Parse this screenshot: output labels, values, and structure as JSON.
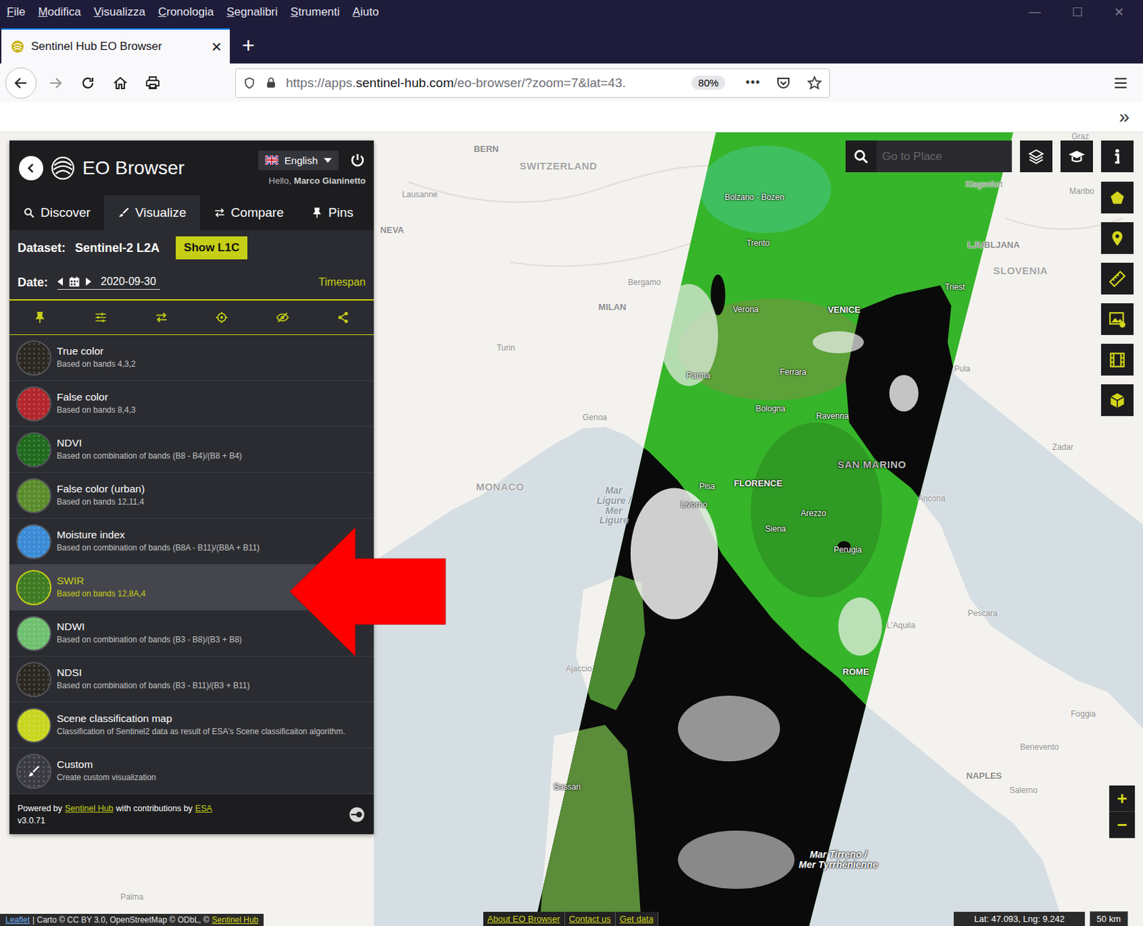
{
  "browser": {
    "menu": [
      "File",
      "Modifica",
      "Visualizza",
      "Cronologia",
      "Segnalibri",
      "Strumenti",
      "Aiuto"
    ],
    "windowControls": [
      "—",
      "☐",
      "✕"
    ],
    "tab": {
      "title": "Sentinel Hub EO Browser",
      "close": "×",
      "selected": true
    },
    "newTab": "+",
    "url": {
      "prefix": "https://apps.",
      "host": "sentinel-hub.com",
      "rest": "/eo-browser/?zoom=7&lat=43."
    },
    "zoom": "80%",
    "more": "•••",
    "overflow": "»"
  },
  "panel": {
    "title": "EO Browser",
    "language": "English",
    "greeting": "Hello,",
    "user": "Marco Gianinetto",
    "tabs": [
      {
        "label": "Discover",
        "selected": false
      },
      {
        "label": "Visualize",
        "selected": true
      },
      {
        "label": "Compare",
        "selected": false
      },
      {
        "label": "Pins",
        "selected": false
      }
    ],
    "dataset": {
      "label": "Dataset:",
      "value": "Sentinel-2 L2A",
      "button": "Show L1C"
    },
    "date": {
      "label": "Date:",
      "value": "2020-09-30",
      "timespan": "Timespan"
    },
    "layers": [
      {
        "title": "True color",
        "description": "Based on bands 4,3,2",
        "selected": false,
        "kind": "preset",
        "color": "#2b2721"
      },
      {
        "title": "False color",
        "description": "Based on bands 8,4,3",
        "selected": false,
        "kind": "preset",
        "color": "#b3262b"
      },
      {
        "title": "NDVI",
        "description": "Based on combination of bands (B8 - B4)/(B8 + B4)",
        "selected": false,
        "kind": "preset",
        "color": "#1f6a1d"
      },
      {
        "title": "False color (urban)",
        "description": "Based on bands 12,11,4",
        "selected": false,
        "kind": "preset",
        "color": "#5b8c2c"
      },
      {
        "title": "Moisture index",
        "description": "Based on combination of bands (B8A - B11)/(B8A + B11)",
        "selected": false,
        "kind": "preset",
        "color": "#3b8bd6"
      },
      {
        "title": "SWIR",
        "description": "Based on bands 12,8A,4",
        "selected": true,
        "kind": "preset",
        "color": "#3e7b22"
      },
      {
        "title": "NDWI",
        "description": "Based on combination of bands (B3 - B8)/(B3 + B8)",
        "selected": false,
        "kind": "preset",
        "color": "#6fc06f"
      },
      {
        "title": "NDSI",
        "description": "Based on combination of bands (B3 - B11)/(B3 + B11)",
        "selected": false,
        "kind": "preset",
        "color": "#2b2721"
      },
      {
        "title": "Scene classification map",
        "description": "Classification of Sentinel2 data as result of ESA's Scene classificaiton algorithm.",
        "selected": false,
        "kind": "preset",
        "color": "#c9d620"
      },
      {
        "title": "Custom",
        "description": "Create custom visualization",
        "selected": false,
        "kind": "custom",
        "color": "#3a3b42"
      }
    ],
    "footer": {
      "parts": [
        {
          "text": "Powered by",
          "link": false
        },
        {
          "text": "Sentinel Hub",
          "link": true
        },
        {
          "text": "with contributions by",
          "link": false
        },
        {
          "text": "ESA",
          "link": true
        }
      ],
      "version": "v3.0.71"
    }
  },
  "map": {
    "search": {
      "placeholder": "Go to Place"
    },
    "zoom": [
      "+",
      "−"
    ],
    "labels": [
      {
        "text": "BERN",
        "kind": "capital",
        "onImage": false
      },
      {
        "text": "SWITZERLAND",
        "kind": "country",
        "onImage": false
      },
      {
        "text": "Lausanne",
        "kind": "town",
        "onImage": false
      },
      {
        "text": "NEVA",
        "kind": "capital",
        "onImage": false
      },
      {
        "text": "Bergamo",
        "kind": "town",
        "onImage": false
      },
      {
        "text": "MILAN",
        "kind": "capital",
        "onImage": false
      },
      {
        "text": "Turin",
        "kind": "town",
        "onImage": false
      },
      {
        "text": "Genoa",
        "kind": "town",
        "onImage": false
      },
      {
        "text": "MONACO",
        "kind": "country",
        "onImage": false
      },
      {
        "lines": [
          "Mar",
          "Ligure /",
          "Mer",
          "Ligure"
        ],
        "kind": "sea",
        "onImage": false
      },
      {
        "text": "Bolzano - Bozen",
        "kind": "town",
        "onImage": true
      },
      {
        "text": "Klagenfurt",
        "kind": "town",
        "onImage": false
      },
      {
        "text": "Graz",
        "kind": "town",
        "onImage": false
      },
      {
        "text": "Maribo",
        "kind": "town",
        "onImage": false
      },
      {
        "text": "Trento",
        "kind": "town",
        "onImage": true
      },
      {
        "text": "LJUBLJANA",
        "kind": "capital",
        "onImage": false
      },
      {
        "text": "SLOVENIA",
        "kind": "country",
        "onImage": false
      },
      {
        "text": "Triest",
        "kind": "town",
        "onImage": true
      },
      {
        "text": "Verona",
        "kind": "town",
        "onImage": true
      },
      {
        "text": "VENICE",
        "kind": "capital",
        "onImage": true
      },
      {
        "text": "Parma",
        "kind": "town",
        "onImage": true
      },
      {
        "text": "Ferrara",
        "kind": "town",
        "onImage": true
      },
      {
        "text": "Pula",
        "kind": "town",
        "onImage": false
      },
      {
        "text": "Bologna",
        "kind": "town",
        "onImage": true
      },
      {
        "text": "Ravenna",
        "kind": "town",
        "onImage": true
      },
      {
        "text": "Zadar",
        "kind": "town",
        "onImage": false
      },
      {
        "text": "SAN MARINO",
        "kind": "country",
        "onImage": true
      },
      {
        "text": "FLORENCE",
        "kind": "capital",
        "onImage": true
      },
      {
        "text": "Pisa",
        "kind": "town",
        "onImage": true
      },
      {
        "text": "Ancona",
        "kind": "town",
        "onImage": false
      },
      {
        "text": "Livorno",
        "kind": "town",
        "onImage": true
      },
      {
        "text": "Arezzo",
        "kind": "town",
        "onImage": true
      },
      {
        "text": "Siena",
        "kind": "town",
        "onImage": true
      },
      {
        "text": "Perugia",
        "kind": "town",
        "onImage": true
      },
      {
        "text": "Pescara",
        "kind": "town",
        "onImage": false
      },
      {
        "text": "L'Aquila",
        "kind": "town",
        "onImage": false
      },
      {
        "text": "Ajaccio",
        "kind": "town",
        "onImage": false
      },
      {
        "text": "ROME",
        "kind": "capital",
        "onImage": true
      },
      {
        "text": "Foggia",
        "kind": "town",
        "onImage": false
      },
      {
        "text": "Benevento",
        "kind": "town",
        "onImage": false
      },
      {
        "text": "NAPLES",
        "kind": "capital",
        "onImage": false
      },
      {
        "text": "Salerno",
        "kind": "town",
        "onImage": false
      },
      {
        "text": "Sassari",
        "kind": "town",
        "onImage": true
      },
      {
        "lines": [
          "Mar Tirreno /",
          "Mer Tyrrhénienne"
        ],
        "kind": "sea",
        "onImage": true
      },
      {
        "text": "Palma",
        "kind": "town",
        "onImage": false
      }
    ],
    "attribution": [
      {
        "text": "Leaflet",
        "link": true
      },
      {
        "text": "| Carto © CC BY 3.0, OpenStreetMap © ODbL, ©",
        "link": false
      },
      {
        "text": "Sentinel Hub",
        "link": true
      }
    ],
    "links": [
      "About EO Browser",
      "Contact us",
      "Get data"
    ],
    "coords": "Lat: 47.093, Lng: 9.242",
    "scale": "50 km"
  }
}
